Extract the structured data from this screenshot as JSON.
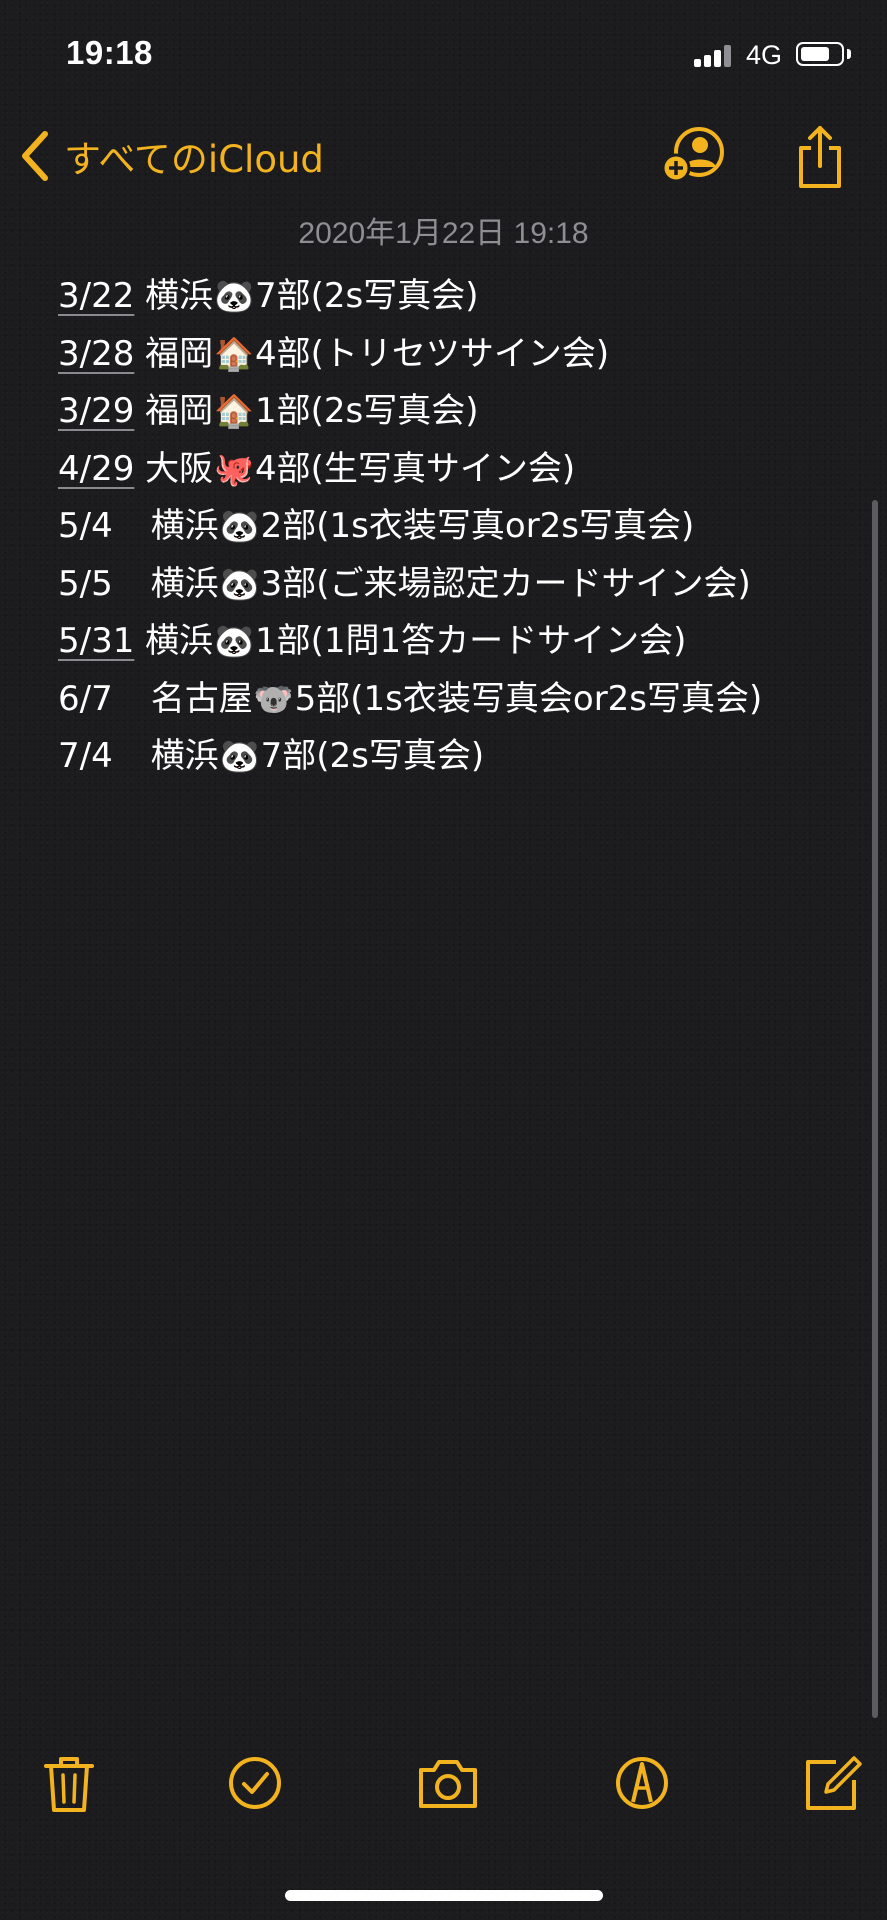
{
  "status_bar": {
    "time": "19:18",
    "network": "4G",
    "battery_level": 0.7
  },
  "nav": {
    "back_label": "すべてのiCloud",
    "accent_color": "#f2b31f"
  },
  "note": {
    "timestamp": "2020年1月22日 19:18",
    "lines": [
      {
        "date": "3/22",
        "rest": " 横浜",
        "emoji": "🐼",
        "detail": "7部(2s写真会)"
      },
      {
        "date": "3/28",
        "rest": " 福岡",
        "emoji": "🏠",
        "detail": "4部(トリセツサイン会)"
      },
      {
        "date": "3/29",
        "rest": " 福岡",
        "emoji": "🏠",
        "detail": "1部(2s写真会)"
      },
      {
        "date": "4/29",
        "rest": " 大阪",
        "emoji": "🐙",
        "detail": "4部(生写真サイン会)"
      },
      {
        "date": "5/4",
        "rest": " 横浜",
        "emoji": "🐼",
        "detail": "2部(1s衣装写真or2s写真会)"
      },
      {
        "date": "5/5",
        "rest": " 横浜",
        "emoji": "🐼",
        "detail": "3部(ご来場認定カードサイン会)"
      },
      {
        "date": "5/31",
        "rest": " 横浜",
        "emoji": "🐼",
        "detail": "1部(1問1答カードサイン会)"
      },
      {
        "date": "6/7",
        "rest": " 名古屋",
        "emoji": "🐨",
        "detail": "5部(1s衣装写真会or2s写真会)"
      },
      {
        "date": "7/4",
        "rest": " 横浜",
        "emoji": "🐼",
        "detail": "7部(2s写真会)"
      }
    ]
  },
  "toolbar": {
    "icons": [
      "trash-icon",
      "checklist-icon",
      "camera-icon",
      "markup-icon",
      "compose-icon"
    ]
  }
}
